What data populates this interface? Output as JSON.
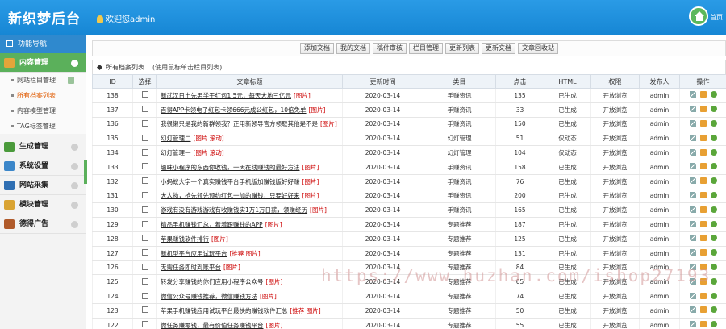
{
  "header": {
    "logo": "新织梦后台",
    "welcome": "欢迎您admin",
    "home_label": "首页"
  },
  "sidebar": {
    "top_label": "功能导航",
    "sections": [
      {
        "label": "内容管理",
        "active": true,
        "icon": "edit-icon",
        "color": "#e4a53a",
        "subs": [
          {
            "label": "网站栏目管理",
            "current": false
          },
          {
            "label": "所有档案列表",
            "current": true
          },
          {
            "label": "内容模型管理",
            "current": false
          },
          {
            "label": "TAG标签管理",
            "current": false
          }
        ]
      },
      {
        "label": "生成管理",
        "icon": "tree-icon",
        "color": "#4a9a3b"
      },
      {
        "label": "系统设置",
        "icon": "gear-icon",
        "color": "#3b86c9"
      },
      {
        "label": "网站采集",
        "icon": "monitor-icon",
        "color": "#2f6fb3"
      },
      {
        "label": "模块管理",
        "icon": "box-icon",
        "color": "#d9a332"
      },
      {
        "label": "德得广告",
        "icon": "book-icon",
        "color": "#b05a2a"
      }
    ]
  },
  "toolbar": {
    "buttons": [
      "添加文档",
      "我的文档",
      "稿件审核",
      "栏目管理",
      "更新列表",
      "更新文档",
      "文章回收站"
    ]
  },
  "list": {
    "title": "所有档案列表",
    "note": "(使用鼠标单击栏目列表)",
    "columns": [
      "ID",
      "选择",
      "文章标题",
      "更新时间",
      "类目",
      "点击",
      "HTML",
      "权限",
      "发布人",
      "操作"
    ],
    "rows": [
      {
        "id": "138",
        "title": "新武汉日土先男学于红包1.5元，每天大地三亿元",
        "flag": "[图片]",
        "date": "2020-03-14",
        "cat": "手赚资讯",
        "hits": "135",
        "html": "已生成",
        "perm": "开放浏览",
        "author": "admin"
      },
      {
        "id": "137",
        "title": "百得APP卡领电子红包卡领666元成公红包，10倍免单",
        "flag": "[图片]",
        "date": "2020-03-14",
        "cat": "手赚资讯",
        "hits": "33",
        "html": "已生成",
        "perm": "开放浏览",
        "author": "admin"
      },
      {
        "id": "136",
        "title": "我很懒只是我的新群领我？正用新领导官方领取其他是不是",
        "flag": "[图片]",
        "date": "2020-03-14",
        "cat": "手赚资讯",
        "hits": "150",
        "html": "已生成",
        "perm": "开放浏览",
        "author": "admin"
      },
      {
        "id": "135",
        "title": "幻灯管理二",
        "flag": "[图片 滚动]",
        "date": "2020-03-14",
        "cat": "幻灯管理",
        "hits": "51",
        "html": "仅动态",
        "perm": "开放浏览",
        "author": "admin"
      },
      {
        "id": "134",
        "title": "幻灯管理一",
        "flag": "[图片 滚动]",
        "date": "2020-03-14",
        "cat": "幻灯管理",
        "hits": "104",
        "html": "仅动态",
        "perm": "开放浏览",
        "author": "admin"
      },
      {
        "id": "133",
        "title": "趣味小程序的东西你收钱，一天在线赚钱的最好方法",
        "flag": "[图片]",
        "date": "2020-03-14",
        "cat": "手赚资讯",
        "hits": "158",
        "html": "已生成",
        "perm": "开放浏览",
        "author": "admin"
      },
      {
        "id": "132",
        "title": "小蚂蚁大字一个真实赚钱平台手机版加赚钱版好好赚",
        "flag": "[图片]",
        "date": "2020-03-14",
        "cat": "手赚资讯",
        "hits": "76",
        "html": "已生成",
        "perm": "开放浏览",
        "author": "admin"
      },
      {
        "id": "131",
        "title": "大人物，抢先领先预约红包一加的赚钱，只要好好来",
        "flag": "[图片]",
        "date": "2020-03-14",
        "cat": "手赚资讯",
        "hits": "200",
        "html": "已生成",
        "perm": "开放浏览",
        "author": "admin"
      },
      {
        "id": "130",
        "title": "游戏有没有游戏游戏有收赚钱实1万1万日薪，领赚经历",
        "flag": "[图片]",
        "date": "2020-03-14",
        "cat": "手赚资讯",
        "hits": "165",
        "html": "已生成",
        "perm": "开放浏览",
        "author": "admin"
      },
      {
        "id": "129",
        "title": "精品手机赚钱汇总，着着跟赚钱的APP",
        "flag": "[图片]",
        "date": "2020-03-14",
        "cat": "专题推荐",
        "hits": "187",
        "html": "已生成",
        "perm": "开放浏览",
        "author": "admin"
      },
      {
        "id": "128",
        "title": "苹果赚钱软件排行",
        "flag": "[图片]",
        "date": "2020-03-14",
        "cat": "专题推荐",
        "hits": "125",
        "html": "已生成",
        "perm": "开放浏览",
        "author": "admin"
      },
      {
        "id": "127",
        "title": "新机型平台应用试玩平台",
        "flag": "[推荐 图片]",
        "date": "2020-03-14",
        "cat": "专题推荐",
        "hits": "131",
        "html": "已生成",
        "perm": "开放浏览",
        "author": "admin"
      },
      {
        "id": "126",
        "title": "无需任务即时到账平台",
        "flag": "[图片]",
        "date": "2020-03-14",
        "cat": "专题推荐",
        "hits": "84",
        "html": "已生成",
        "perm": "开放浏览",
        "author": "admin"
      },
      {
        "id": "125",
        "title": "转发分享赚钱的你们应用小程序公众号",
        "flag": "[图片]",
        "date": "2020-03-14",
        "cat": "专题推荐",
        "hits": "65",
        "html": "已生成",
        "perm": "开放浏览",
        "author": "admin"
      },
      {
        "id": "124",
        "title": "微信公众号赚钱推荐，微信赚钱方法",
        "flag": "[图片]",
        "date": "2020-03-14",
        "cat": "专题推荐",
        "hits": "74",
        "html": "已生成",
        "perm": "开放浏览",
        "author": "admin"
      },
      {
        "id": "123",
        "title": "苹果手机赚钱应用试玩平台最快的赚钱软件汇总",
        "flag": "[推荐 图片]",
        "date": "2020-03-14",
        "cat": "专题推荐",
        "hits": "50",
        "html": "已生成",
        "perm": "开放浏览",
        "author": "admin"
      },
      {
        "id": "122",
        "title": "微任务赚零钱，最有价值任务赚钱平台",
        "flag": "[图片]",
        "date": "2020-03-14",
        "cat": "专题推荐",
        "hits": "55",
        "html": "已生成",
        "perm": "开放浏览",
        "author": "admin"
      }
    ]
  },
  "watermark": "https://www.huzhan.com/ishop27193"
}
